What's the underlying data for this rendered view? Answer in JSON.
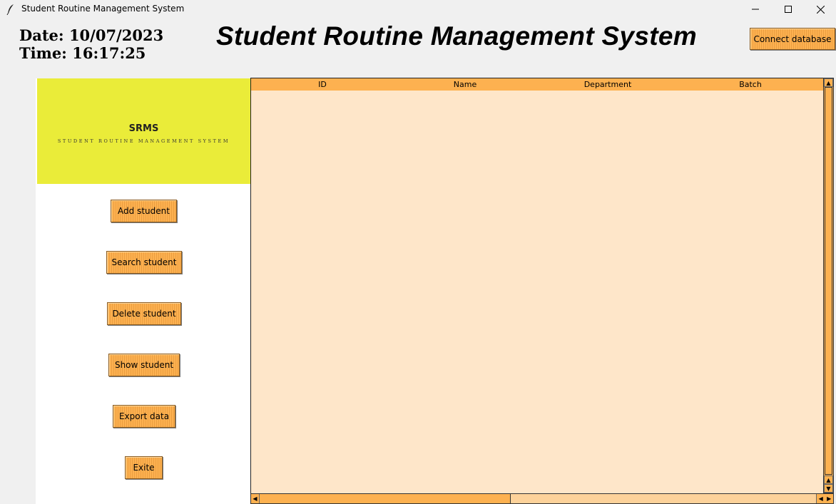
{
  "window": {
    "title": "Student Routine Management System",
    "icon": "feather-icon"
  },
  "header": {
    "date": "Date: 10/07/2023",
    "time": "Time: 16:17:25",
    "title": "Student Routine Management System",
    "connect_label": "Connect database"
  },
  "logo": {
    "title": "SRMS",
    "subtitle": "STUDENT ROUTINE MANAGEMENT SYSTEM"
  },
  "sidebar": {
    "buttons": [
      {
        "label": "Add student"
      },
      {
        "label": "Search student"
      },
      {
        "label": "Delete student"
      },
      {
        "label": "Show student"
      },
      {
        "label": "Export data"
      },
      {
        "label": "Exite"
      }
    ]
  },
  "table": {
    "columns": [
      "ID",
      "Name",
      "Department",
      "Batch"
    ],
    "rows": []
  },
  "colors": {
    "button_orange": "#fdb150",
    "logo_yellow": "#eaec39",
    "table_bg": "#fee6c9"
  }
}
